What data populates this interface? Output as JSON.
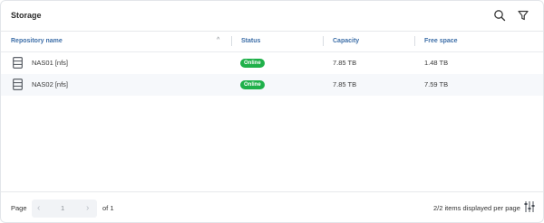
{
  "header": {
    "title": "Storage",
    "search_icon": "search-icon",
    "filter_icon": "filter-icon"
  },
  "columns": {
    "name": "Repository name",
    "status": "Status",
    "capacity": "Capacity",
    "free": "Free space",
    "sort_indicator": "^"
  },
  "rows": [
    {
      "name": "NAS01 [nfs]",
      "status": "Online",
      "capacity": "7.85 TB",
      "free": "1.48 TB"
    },
    {
      "name": "NAS02 [nfs]",
      "status": "Online",
      "capacity": "7.85 TB",
      "free": "7.59 TB"
    }
  ],
  "footer": {
    "page_label": "Page",
    "page_value": "1",
    "of_label": "of 1",
    "prev_symbol": "‹",
    "next_symbol": "›",
    "items_text": "2/2 items displayed per page"
  },
  "colors": {
    "accent": "#3e6fa8",
    "online": "#1fb04a"
  }
}
